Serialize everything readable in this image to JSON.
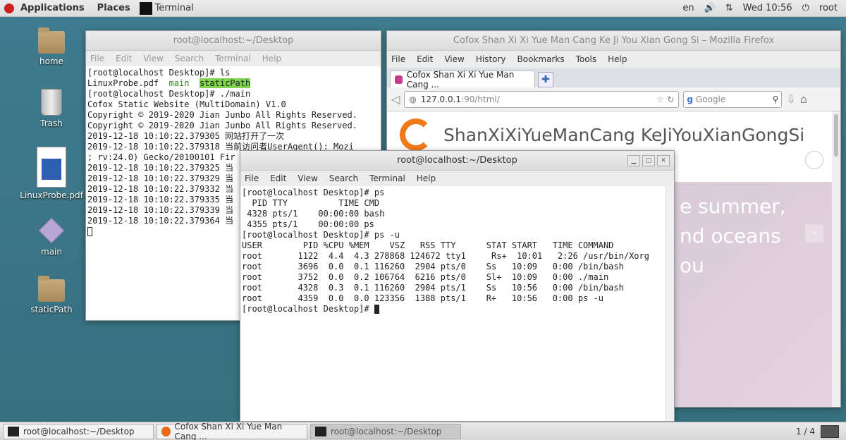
{
  "topbar": {
    "applications": "Applications",
    "places": "Places",
    "terminal": "Terminal",
    "lang": "en",
    "clock": "Wed 10:56",
    "user": "root"
  },
  "desktop": {
    "icons": [
      "home",
      "Trash",
      "LinuxProbe.pdf",
      "main",
      "staticPath"
    ]
  },
  "term1": {
    "title": "root@localhost:~/Desktop",
    "menu": [
      "File",
      "Edit",
      "View",
      "Search",
      "Terminal",
      "Help"
    ],
    "lines": {
      "l1": "[root@localhost Desktop]# ls",
      "l2a": "LinuxProbe.pdf  ",
      "l2b": "main",
      "l2c": "  ",
      "l2d": "staticPath",
      "l3": "[root@localhost Desktop]# ./main",
      "l4": "Cofox Static Website (MultiDomain) V1.0",
      "l5": "Copyright © 2019-2020 Jian Junbo All Rights Reserved.",
      "l6": "Copyright © 2019-2020 Jian Junbo All Rights Reserved.",
      "l7": "2019-12-18 10:10:22.379305 网站打开了一次",
      "l8": "2019-12-18 10:10:22.379318 当前访问者UserAgent(): Mozi",
      "l9": "; rv:24.0) Gecko/20100101 Fir",
      "l10": "2019-12-18 10:10:22.379325 当",
      "l11": "2019-12-18 10:10:22.379329 当",
      "l12": "2019-12-18 10:10:22.379332 当",
      "l13": "2019-12-18 10:10:22.379335 当",
      "l14": "2019-12-18 10:10:22.379339 当",
      "l15": "2019-12-18 10:10:22.379364 当"
    }
  },
  "firefox": {
    "title": "Cofox Shan Xi Xi Yue Man Cang Ke Ji You Xian Gong Si – Mozilla Firefox",
    "menu": [
      "File",
      "Edit",
      "View",
      "History",
      "Bookmarks",
      "Tools",
      "Help"
    ],
    "tab": "Cofox Shan Xi Xi Yue Man Cang ...",
    "url_host": "127.0.0.1",
    "url_rest": ":90/html/",
    "search_placeholder": "Google",
    "brand": "ShanXiXiYueManCang KeJiYouXianGongSi",
    "hero1": "e summer,",
    "hero2": "nd oceans",
    "hero3": "ou"
  },
  "term2": {
    "title": "root@localhost:~/Desktop",
    "menu": [
      "File",
      "Edit",
      "View",
      "Search",
      "Terminal",
      "Help"
    ],
    "lines": {
      "l1": "[root@localhost Desktop]# ps",
      "l2": "  PID TTY          TIME CMD",
      "l3": " 4328 pts/1    00:00:00 bash",
      "l4": " 4355 pts/1    00:00:00 ps",
      "l5": "[root@localhost Desktop]# ps -u",
      "l6": "USER        PID %CPU %MEM    VSZ   RSS TTY      STAT START   TIME COMMAND",
      "l7": "root       1122  4.4  4.3 278868 124672 tty1     Rs+  10:01   2:26 /usr/bin/Xorg",
      "l8": "root       3696  0.0  0.1 116260  2904 pts/0    Ss   10:09   0:00 /bin/bash",
      "l9": "root       3752  0.0  0.2 106764  6216 pts/0    Sl+  10:09   0:00 ./main",
      "l10": "root       4328  0.3  0.1 116260  2904 pts/1    Ss   10:56   0:00 /bin/bash",
      "l11": "root       4359  0.0  0.0 123356  1388 pts/1    R+   10:56   0:00 ps -u",
      "l12": "[root@localhost Desktop]# "
    }
  },
  "taskbar": {
    "t1": "root@localhost:~/Desktop",
    "t2": "Cofox Shan Xi Xi Yue Man Cang ...",
    "t3": "root@localhost:~/Desktop",
    "pager": "1 / 4"
  }
}
